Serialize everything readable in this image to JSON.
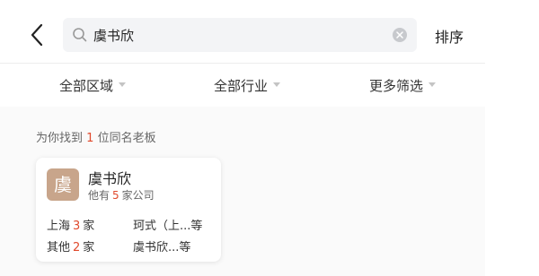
{
  "search": {
    "query": "虞书欣",
    "sort_label": "排序"
  },
  "filters": [
    {
      "label": "全部区域"
    },
    {
      "label": "全部行业"
    },
    {
      "label": "更多筛选"
    }
  ],
  "results": {
    "prefix": "为你找到",
    "count": "1",
    "suffix": "位同名老板"
  },
  "card": {
    "avatar_char": "虞",
    "name": "虞书欣",
    "companies_prefix": "他有",
    "companies_count": "5",
    "companies_suffix": "家公司",
    "regions": [
      {
        "name": "上海",
        "count": "3",
        "unit": "家"
      },
      {
        "name": "其他",
        "count": "2",
        "unit": "家"
      }
    ],
    "companies": [
      "珂式（上...等",
      "虞书欣...等"
    ]
  },
  "colors": {
    "accent_red": "#e0492c",
    "avatar_bg": "#c8a58b",
    "search_bg": "#f3f4f6"
  },
  "icons": {
    "back": "chevron-left-icon",
    "search": "search-icon",
    "clear": "clear-circle-icon",
    "filter_caret": "caret-down-icon"
  }
}
